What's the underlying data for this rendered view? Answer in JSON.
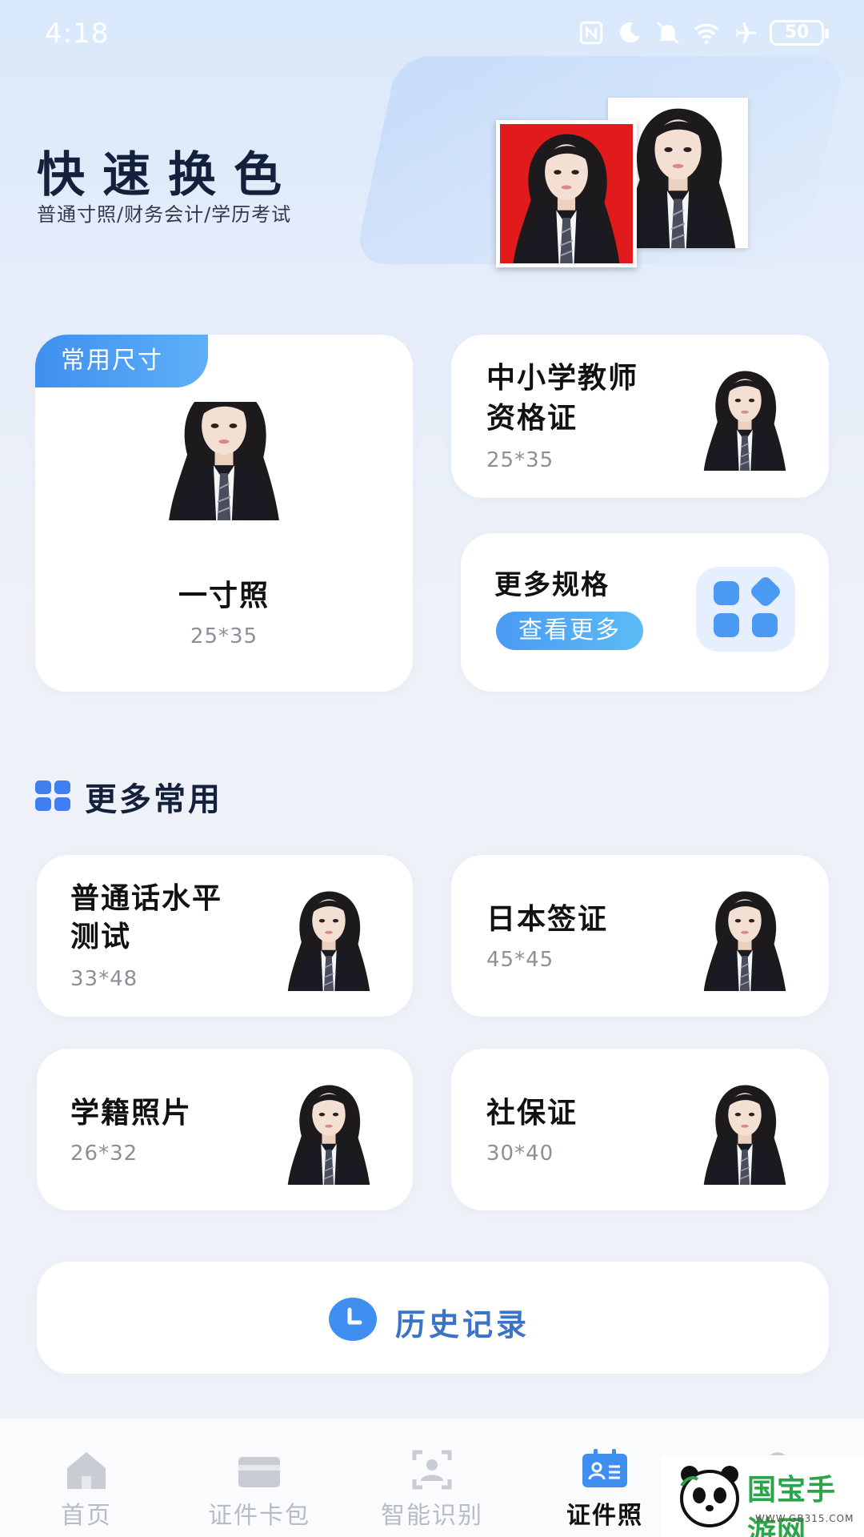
{
  "status_bar": {
    "time": "4:18",
    "battery": "50"
  },
  "hero": {
    "title": "快速换色",
    "subtitle": "普通寸照/财务会计/学历考试",
    "accent_color": "#e11b1b"
  },
  "featured": {
    "tag": "常用尺寸",
    "title": "一寸照",
    "size": "25*35"
  },
  "teacher_card": {
    "title_line1": "中小学教师",
    "title_line2": "资格证",
    "size": "25*35"
  },
  "more_specs": {
    "title": "更多规格",
    "button": "查看更多",
    "icon": "grid-icon"
  },
  "section": {
    "title": "更多常用",
    "icon": "grid-icon"
  },
  "items": [
    {
      "title_line1": "普通话水平",
      "title_line2": "测试",
      "size": "33*48"
    },
    {
      "title_line1": "日本签证",
      "title_line2": "",
      "size": "45*45"
    },
    {
      "title_line1": "学籍照片",
      "title_line2": "",
      "size": "26*32"
    },
    {
      "title_line1": "社保证",
      "title_line2": "",
      "size": "30*40"
    }
  ],
  "history": {
    "label": "历史记录",
    "icon": "clock-icon"
  },
  "nav": [
    {
      "label": "首页",
      "icon": "home-icon",
      "active": false
    },
    {
      "label": "证件卡包",
      "icon": "wallet-icon",
      "active": false
    },
    {
      "label": "智能识别",
      "icon": "scan-icon",
      "active": false
    },
    {
      "label": "证件照",
      "icon": "id-card-icon",
      "active": true
    },
    {
      "label": "",
      "icon": "profile-icon",
      "active": false
    }
  ],
  "watermark": {
    "text": "国宝手游网",
    "url": "WWW.GB315.COM"
  },
  "colors": {
    "accent": "#3f8ff0",
    "history_text": "#3b73c6",
    "background": "#eef1f7"
  }
}
